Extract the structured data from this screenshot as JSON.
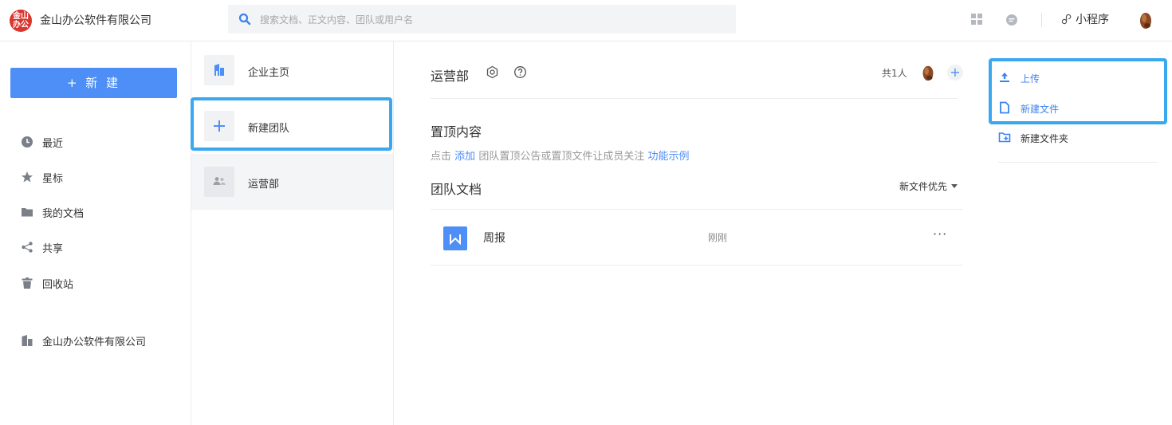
{
  "header": {
    "logo_text": "金山\n办公",
    "company_name": "金山办公软件有限公司",
    "search_placeholder": "搜索文档、正文内容、团队或用户名",
    "mini_program_label": "小程序"
  },
  "sidebar": {
    "new_button": "+ 新 建",
    "items": [
      {
        "label": "最近",
        "icon": "clock-icon"
      },
      {
        "label": "星标",
        "icon": "star-icon"
      },
      {
        "label": "我的文档",
        "icon": "folder-icon"
      },
      {
        "label": "共享",
        "icon": "share-icon"
      },
      {
        "label": "回收站",
        "icon": "trash-icon"
      }
    ],
    "company_item": "金山办公软件有限公司"
  },
  "teams": {
    "items": [
      {
        "label": "企业主页",
        "icon": "building-icon"
      },
      {
        "label": "新建团队",
        "icon": "plus-icon"
      },
      {
        "label": "运营部",
        "icon": "team-icon"
      }
    ]
  },
  "main": {
    "title": "运营部",
    "member_count": "共1人",
    "add_member": "+",
    "pinned_title": "置顶内容",
    "pinned_hint_pre": "点击",
    "pinned_hint_link": "添加",
    "pinned_hint_mid": "团队置顶公告或置顶文件让成员关注",
    "pinned_hint_example": "功能示例",
    "docs_title": "团队文档",
    "sort_label": "新文件优先",
    "files": [
      {
        "name": "周报",
        "time": "刚刚",
        "more": "···",
        "icon": "word-doc-icon"
      }
    ]
  },
  "actions": {
    "upload": "上传",
    "new_file": "新建文件",
    "new_folder": "新建文件夹"
  },
  "colors": {
    "accent": "#4e8ef7",
    "highlight": "#3aa8f0",
    "logo": "#d9362f"
  }
}
